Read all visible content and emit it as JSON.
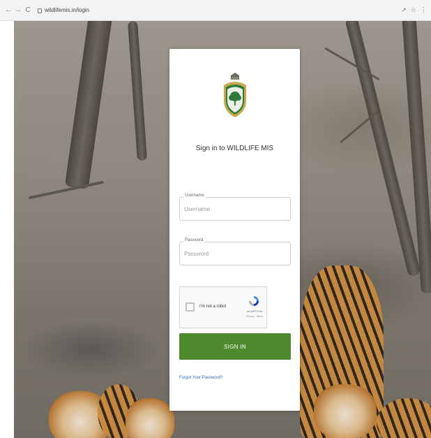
{
  "browser": {
    "url": "wildlifemis.in/login",
    "back": "←",
    "forward": "→",
    "reload": "C"
  },
  "login": {
    "title": "Sign in to WILDLIFE MIS",
    "username_label": "Username",
    "username_placeholder": "Username",
    "password_label": "Password",
    "password_placeholder": "Password",
    "signin_label": "SIGN IN",
    "forgot_label": "Forgot Your Password?"
  },
  "captcha": {
    "label": "I'm not a robot",
    "brand": "reCAPTCHA",
    "links": "Privacy - Terms"
  },
  "colors": {
    "primary_green": "#4f8a2e",
    "link_blue": "#2a6bb0",
    "logo_green": "#2f7a3a",
    "logo_gold": "#c9a84c"
  },
  "icons": [
    "lock-icon",
    "shield-logo-icon",
    "recaptcha-icon",
    "share-icon",
    "star-icon",
    "extension-icon"
  ]
}
